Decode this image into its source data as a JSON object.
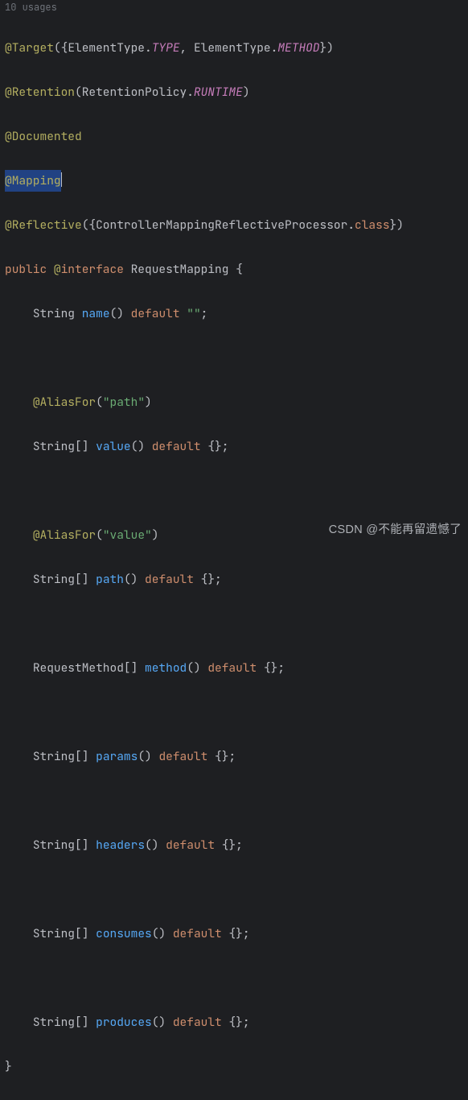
{
  "hint": "10 usages",
  "watermark": "CSDN @不能再留遗憾了",
  "code": {
    "l1": {
      "at_target": "@Target",
      "p1": "({",
      "et": "ElementType",
      "dot": ".",
      "type": "TYPE",
      "comma": ", ",
      "et2": "ElementType",
      "dot2": ".",
      "method_c": "METHOD",
      "p2": "})"
    },
    "l2": {
      "at_ret": "@Retention",
      "p1": "(",
      "rp": "RetentionPolicy",
      "dot": ".",
      "runtime": "RUNTIME",
      "p2": ")"
    },
    "l3": {
      "at_doc": "@Documented"
    },
    "l4": {
      "at_map": "@Mapping"
    },
    "l5": {
      "at_refl": "@Reflective",
      "p1": "({",
      "proc": "ControllerMappingReflectiveProcessor",
      "dot": ".",
      "cls": "class",
      "p2": "})"
    },
    "l6": {
      "pub": "public ",
      "at": "@",
      "iface": "interface ",
      "name": "RequestMapping",
      "brace": " {"
    },
    "l7": {
      "indent": "    ",
      "type": "String ",
      "name": "name",
      "paren": "() ",
      "def": "default ",
      "str": "\"\"",
      "semi": ";"
    },
    "l9": {
      "indent": "    ",
      "alias": "@AliasFor",
      "p1": "(",
      "str": "\"path\"",
      "p2": ")"
    },
    "l10": {
      "indent": "    ",
      "type": "String[] ",
      "name": "value",
      "paren": "() ",
      "def": "default ",
      "braces": "{};"
    },
    "l12": {
      "indent": "    ",
      "alias": "@AliasFor",
      "p1": "(",
      "str": "\"value\"",
      "p2": ")"
    },
    "l13": {
      "indent": "    ",
      "type": "String[] ",
      "name": "path",
      "paren": "() ",
      "def": "default ",
      "braces": "{};"
    },
    "l15": {
      "indent": "    ",
      "type": "RequestMethod[] ",
      "name": "method",
      "paren": "() ",
      "def": "default ",
      "braces": "{};"
    },
    "l17": {
      "indent": "    ",
      "type": "String[] ",
      "name": "params",
      "paren": "() ",
      "def": "default ",
      "braces": "{};"
    },
    "l19": {
      "indent": "    ",
      "type": "String[] ",
      "name": "headers",
      "paren": "() ",
      "def": "default ",
      "braces": "{};"
    },
    "l21": {
      "indent": "    ",
      "type": "String[] ",
      "name": "consumes",
      "paren": "() ",
      "def": "default ",
      "braces": "{};"
    },
    "l23": {
      "indent": "    ",
      "type": "String[] ",
      "name": "produces",
      "paren": "() ",
      "def": "default ",
      "braces": "{};"
    },
    "l24": {
      "brace": "}"
    }
  }
}
